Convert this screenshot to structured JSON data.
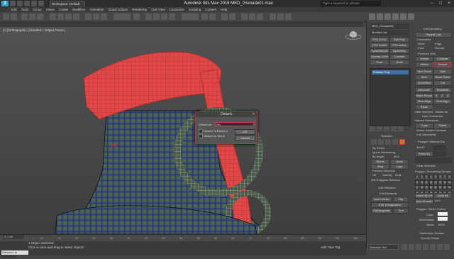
{
  "app": {
    "logo_text": "3",
    "title": "Autodesk 3ds Max 2016      MKD_Grenade01.max",
    "workspace": "Workspace: Default",
    "search_placeholder": "Type a keyword or phrase"
  },
  "menu": [
    "Edit",
    "Tools",
    "Group",
    "Views",
    "Create",
    "Modifiers",
    "Animation",
    "Graph Editors",
    "Rendering",
    "Civil View",
    "Customize",
    "Scripting",
    "Content",
    "Help"
  ],
  "viewport": {
    "label": "[+] [Orthographic ] [Shaded + Edged Faces ]"
  },
  "dialog": {
    "title": "Detach",
    "detach_as_label": "Detach as:",
    "detach_as_value": "Pin",
    "option_element": "Detach To Element",
    "option_clone": "Detach As Clone",
    "ok_label": "OK",
    "cancel_label": "Cancel"
  },
  "right_panel": {
    "object_name": "MKD_Grenade01",
    "modifier_list": "Modifier List",
    "stack_selected": "Editable Poly",
    "modifier_buttons": [
      "FFD 2x2x2",
      "Edit Poly",
      "FFD 3x3x3",
      "FFD 4x4x4",
      "TurboSmooth",
      "Symmetry",
      "Unwrap UVW",
      "Chamfer",
      "Push",
      "Shell"
    ],
    "edit_geometry_title": "Edit Geometry",
    "repeat_last": "Repeat Last",
    "constraints": "Constraints",
    "constraint_opts": [
      "None",
      "Edge",
      "Face",
      "Normal"
    ],
    "preserve_uvs": "Preserve UVs",
    "create": "Create",
    "collapse": "Collapse",
    "attach": "Attach",
    "detach": "Detach",
    "slice_plane": "Slice Plane",
    "split": "Split",
    "slice": "Slice",
    "reset_plane": "Reset Plane",
    "quickslice": "QuickSlice",
    "cut": "Cut",
    "msmooth": "MSmooth",
    "tessellate": "Tessellate",
    "make_planar": "Make Planar",
    "xyz": [
      "X",
      "Y",
      "Z"
    ],
    "view_align": "View Align",
    "grid_align": "Grid Align",
    "relax": "Relax",
    "hide_selected": "Hide Selected",
    "unhide_all": "Unhide All",
    "hide_unselected": "Hide Unselected",
    "named_selections": "Named Selections:",
    "copy": "Copy",
    "paste": "Paste",
    "delete_isolated": "Delete Isolated Vertices",
    "full_interactivity": "Full Interactivity",
    "selection_title": "Selection",
    "by_vertex": "By Vertex",
    "ignore_backfacing": "Ignore Backfacing",
    "by_angle": "By Angle:",
    "by_angle_value": "45.0",
    "shrink": "Shrink",
    "grow": "Grow",
    "ring": "Ring",
    "loop": "Loop",
    "preview_selection": "Preview Selection",
    "preview_opts": [
      "Off",
      "SubObj",
      "Multi"
    ],
    "selected_status": "396 Polygons Selected",
    "soft_selection": "Soft Selection",
    "edit_elements": "Edit Elements",
    "insert_vertex": "Insert Vertex",
    "flip": "Flip",
    "edit_triangulation": "Edit Triangulation",
    "retriangulate": "Retriangulate",
    "turn": "Turn",
    "material_ids_title": "Polygon: Material IDs",
    "set_id": "Set ID:",
    "select_id": "Select ID",
    "clear_selection": "Clear Selection",
    "smoothing_groups_title": "Polygon: Smoothing Groups",
    "auto_smooth": "Auto Smooth",
    "auto_smooth_value": "45.0",
    "select_by_sg": "Select By SG",
    "clear_all": "Clear All",
    "smoothing_numbers": [
      "1",
      "2",
      "3",
      "4",
      "5",
      "6",
      "7",
      "8",
      "9",
      "10",
      "11",
      "12",
      "13",
      "14",
      "15",
      "16",
      "17",
      "18",
      "19",
      "20",
      "21",
      "22",
      "23",
      "24",
      "25",
      "26",
      "27",
      "28",
      "29",
      "30",
      "31",
      "32"
    ],
    "vertex_colors_title": "Polygon: Vertex Colors",
    "color_label": "Color:",
    "illumination_label": "Illumination:",
    "alpha_label": "Alpha:",
    "alpha_value": "100.0",
    "subdivision_title": "Subdivision Surface",
    "smooth_result": "Smooth Result"
  },
  "status": {
    "selected": "1 Object Selected",
    "hint": "Click or click-and-drag to select objects",
    "maxscript": "Welcome to MAXScript.",
    "frame": "0 / 100",
    "add_time_tag": "Add Time Tag",
    "selection_set": "Selection Set:"
  },
  "timeline_ticks": [
    "0",
    "5",
    "10",
    "15",
    "20",
    "25",
    "30",
    "35",
    "40",
    "45",
    "50",
    "55",
    "60",
    "65",
    "70",
    "75",
    "80",
    "85",
    "90",
    "95",
    "100"
  ]
}
